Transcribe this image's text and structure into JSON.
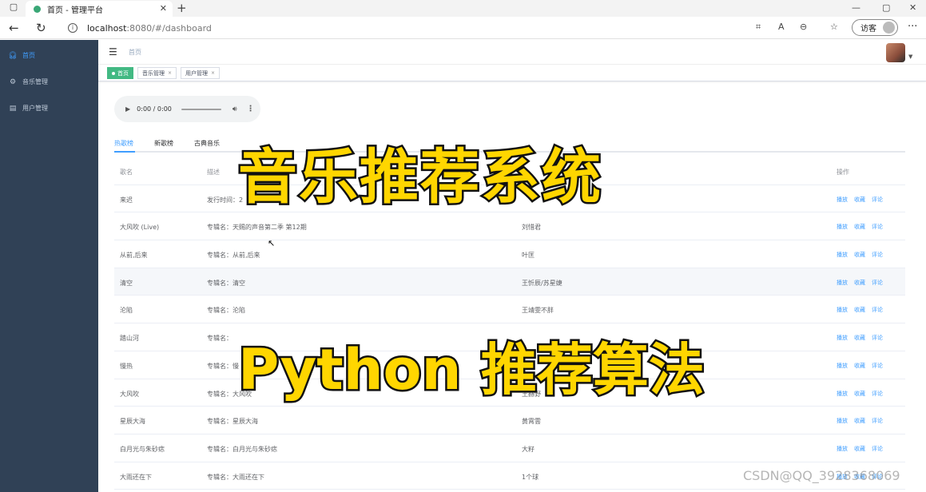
{
  "browser": {
    "tab_title": "首页 - 管理平台",
    "url_host": "localhost",
    "url_rest": ":8080/#/dashboard",
    "guest_label": "访客"
  },
  "sidebar": {
    "items": [
      {
        "label": "首页",
        "icon": "headphones-icon",
        "active": true
      },
      {
        "label": "音乐管理",
        "icon": "gear-icon",
        "active": false
      },
      {
        "label": "用户管理",
        "icon": "document-icon",
        "active": false
      }
    ]
  },
  "header": {
    "breadcrumb": "首页"
  },
  "tags": [
    {
      "label": "首页",
      "active": true
    },
    {
      "label": "音乐管理",
      "active": false
    },
    {
      "label": "用户管理",
      "active": false
    }
  ],
  "player": {
    "time": "0:00 / 0:00"
  },
  "tabs": [
    "热歌榜",
    "新歌榜",
    "古典音乐"
  ],
  "table": {
    "headers": [
      "歌名",
      "描述",
      "",
      "操作"
    ],
    "ops": [
      "播放",
      "收藏",
      "评论"
    ],
    "rows": [
      {
        "name": "来迟",
        "desc": "发行时间：2",
        "artist": "",
        "hl": false
      },
      {
        "name": "大风吹 (Live)",
        "desc": "专辑名：天赐的声音第二季 第12期",
        "artist": "刘惜君",
        "hl": false
      },
      {
        "name": "从前,后来",
        "desc": "专辑名：从前,后来",
        "artist": "叶匡",
        "hl": false
      },
      {
        "name": "清空",
        "desc": "专辑名：清空",
        "artist": "王忻辰/苏星婕",
        "hl": true
      },
      {
        "name": "沦陷",
        "desc": "专辑名：沦陷",
        "artist": "王靖雯不胖",
        "hl": false
      },
      {
        "name": "踏山河",
        "desc": "专辑名：",
        "artist": "",
        "hl": false
      },
      {
        "name": "慢热",
        "desc": "专辑名：慢",
        "artist": "",
        "hl": false
      },
      {
        "name": "大风吹",
        "desc": "专辑名：大风吹",
        "artist": "王赫野",
        "hl": false
      },
      {
        "name": "星辰大海",
        "desc": "专辑名：星辰大海",
        "artist": "黄霄雲",
        "hl": false
      },
      {
        "name": "白月光与朱砂痣",
        "desc": "专辑名：白月光与朱砂痣",
        "artist": "大籽",
        "hl": false
      },
      {
        "name": "大雨还在下",
        "desc": "专辑名：大雨还在下",
        "artist": "1个球",
        "hl": false
      }
    ]
  },
  "overlay": {
    "title": "音乐推荐系统",
    "subtitle": "Python 推荐算法"
  },
  "watermark": "CSDN@QQ_3928368069"
}
